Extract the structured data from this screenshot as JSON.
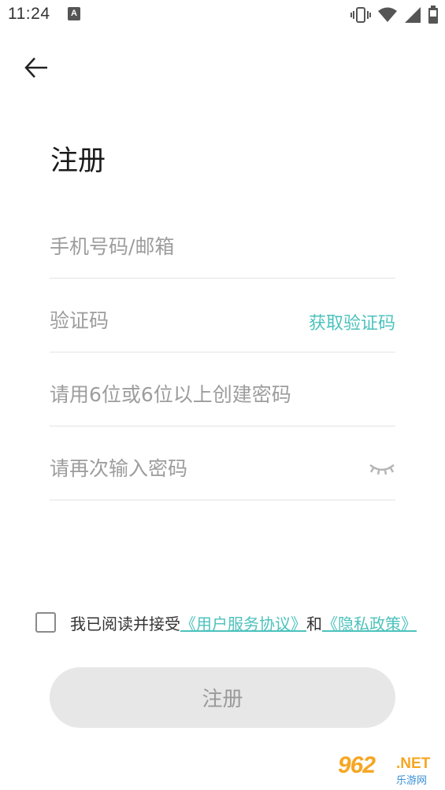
{
  "status_bar": {
    "time": "11:24",
    "notification_badge": "A"
  },
  "header": {
    "title": "注册"
  },
  "form": {
    "phone_email_placeholder": "手机号码/邮箱",
    "code_placeholder": "验证码",
    "get_code_label": "获取验证码",
    "password_placeholder": "请用6位或6位以上创建密码",
    "confirm_password_placeholder": "请再次输入密码"
  },
  "agreement": {
    "prefix": "我已阅读并接受",
    "terms_link": "《用户服务协议》",
    "conjunction": "和",
    "privacy_link": "《隐私政策》"
  },
  "submit": {
    "label": "注册"
  },
  "watermark": {
    "number": "962",
    "suffix": ".NET",
    "site_name": "乐游网"
  },
  "colors": {
    "accent": "#4cc2bd",
    "button_bg": "#e7e7e7",
    "button_text": "#9a9a9a",
    "placeholder": "#9d9d9d"
  },
  "icons": {
    "back": "arrow-left-icon",
    "eye": "eye-closed-icon",
    "vibrate": "vibrate-icon",
    "wifi": "wifi-icon",
    "signal": "signal-icon",
    "battery": "battery-icon"
  }
}
